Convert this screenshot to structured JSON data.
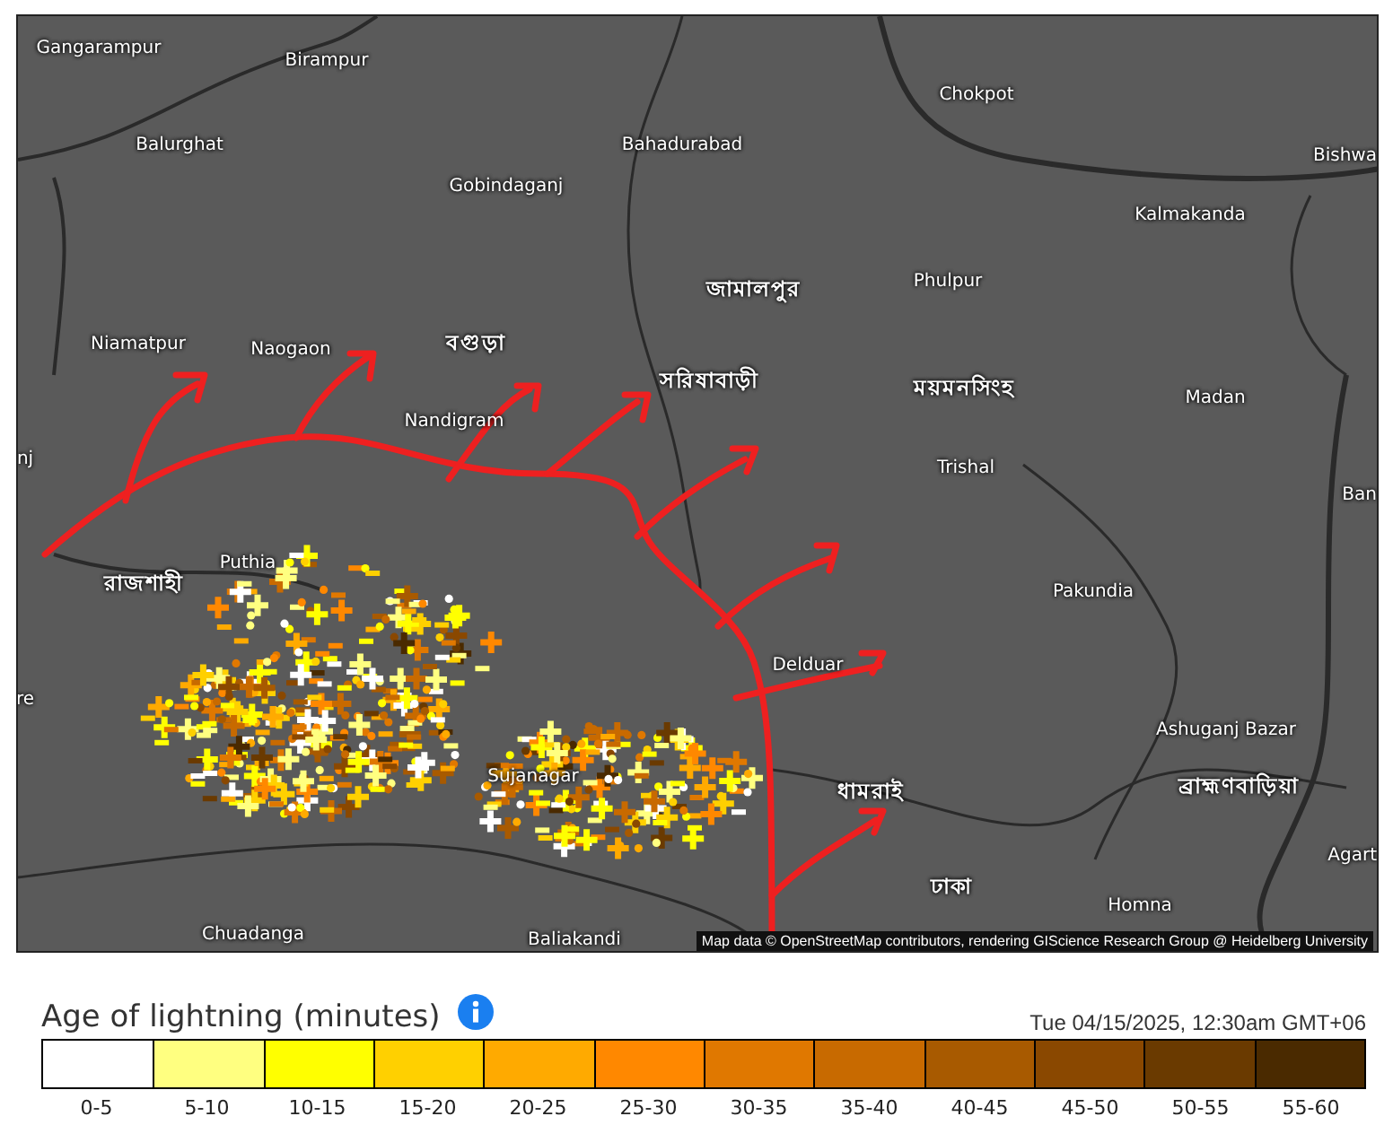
{
  "map": {
    "places": [
      {
        "name": "Gangarampur"
      },
      {
        "name": "Birampur"
      },
      {
        "name": "Chokpot"
      },
      {
        "name": "Balurghat"
      },
      {
        "name": "Bahadurabad"
      },
      {
        "name": "Gobindaganj"
      },
      {
        "name": "Bishwa"
      },
      {
        "name": "Kalmakanda"
      },
      {
        "name": "Phulpur"
      },
      {
        "name": "জামালপুর"
      },
      {
        "name": "Niamatpur"
      },
      {
        "name": "Naogaon"
      },
      {
        "name": "বগুড়া"
      },
      {
        "name": "Madan"
      },
      {
        "name": "সরিষাবাড়ী"
      },
      {
        "name": "ময়মনসিংহ"
      },
      {
        "name": "Nandigram"
      },
      {
        "name": "Trishal"
      },
      {
        "name": "nj"
      },
      {
        "name": "Ban"
      },
      {
        "name": "রাজশাহী"
      },
      {
        "name": "Puthia"
      },
      {
        "name": "Pakundia"
      },
      {
        "name": "re"
      },
      {
        "name": "Delduar"
      },
      {
        "name": "Ashuganj Bazar"
      },
      {
        "name": "Sujanagar"
      },
      {
        "name": "ধামরাই"
      },
      {
        "name": "ব্রাহ্মণবাড়িয়া"
      },
      {
        "name": "Agart"
      },
      {
        "name": "ঢাকা"
      },
      {
        "name": "Homna"
      },
      {
        "name": "Chuadanga"
      },
      {
        "name": "Baliakandi"
      }
    ],
    "attribution": "Map data © OpenStreetMap contributors, rendering GIScience Research Group @ Heidelberg University"
  },
  "legend": {
    "title": "Age of lightning (minutes)",
    "timestamp": "Tue 04/15/2025, 12:30am GMT+06",
    "bins": [
      {
        "label": "0-5",
        "color": "#ffffff"
      },
      {
        "label": "5-10",
        "color": "#ffff80"
      },
      {
        "label": "10-15",
        "color": "#ffff00"
      },
      {
        "label": "15-20",
        "color": "#ffd000"
      },
      {
        "label": "20-25",
        "color": "#ffaa00"
      },
      {
        "label": "25-30",
        "color": "#ff8800"
      },
      {
        "label": "30-35",
        "color": "#e07800"
      },
      {
        "label": "35-40",
        "color": "#c86a00"
      },
      {
        "label": "40-45",
        "color": "#a85a00"
      },
      {
        "label": "45-50",
        "color": "#8a4800"
      },
      {
        "label": "50-55",
        "color": "#6a3a00"
      },
      {
        "label": "55-60",
        "color": "#4a2a00"
      }
    ]
  }
}
